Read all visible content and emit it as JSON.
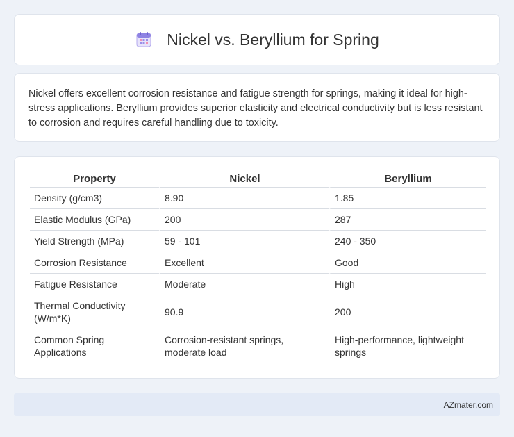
{
  "header": {
    "title": "Nickel vs. Beryllium for Spring",
    "icon": "calendar-icon"
  },
  "description": "Nickel offers excellent corrosion resistance and fatigue strength for springs, making it ideal for high-stress applications. Beryllium provides superior elasticity and electrical conductivity but is less resistant to corrosion and requires careful handling due to toxicity.",
  "table": {
    "headers": [
      "Property",
      "Nickel",
      "Beryllium"
    ],
    "rows": [
      [
        "Density (g/cm3)",
        "8.90",
        "1.85"
      ],
      [
        "Elastic Modulus (GPa)",
        "200",
        "287"
      ],
      [
        "Yield Strength (MPa)",
        "59 - 101",
        "240 - 350"
      ],
      [
        "Corrosion Resistance",
        "Excellent",
        "Good"
      ],
      [
        "Fatigue Resistance",
        "Moderate",
        "High"
      ],
      [
        "Thermal Conductivity (W/m*K)",
        "90.9",
        "200"
      ],
      [
        "Common Spring Applications",
        "Corrosion-resistant springs, moderate load",
        "High-performance, lightweight springs"
      ]
    ]
  },
  "footer": {
    "source": "AZmater.com"
  },
  "colors": {
    "background": "#eef2f8",
    "card": "#ffffff",
    "footer_bg": "#e3eaf6",
    "icon_accent": "#7b6fd6"
  }
}
